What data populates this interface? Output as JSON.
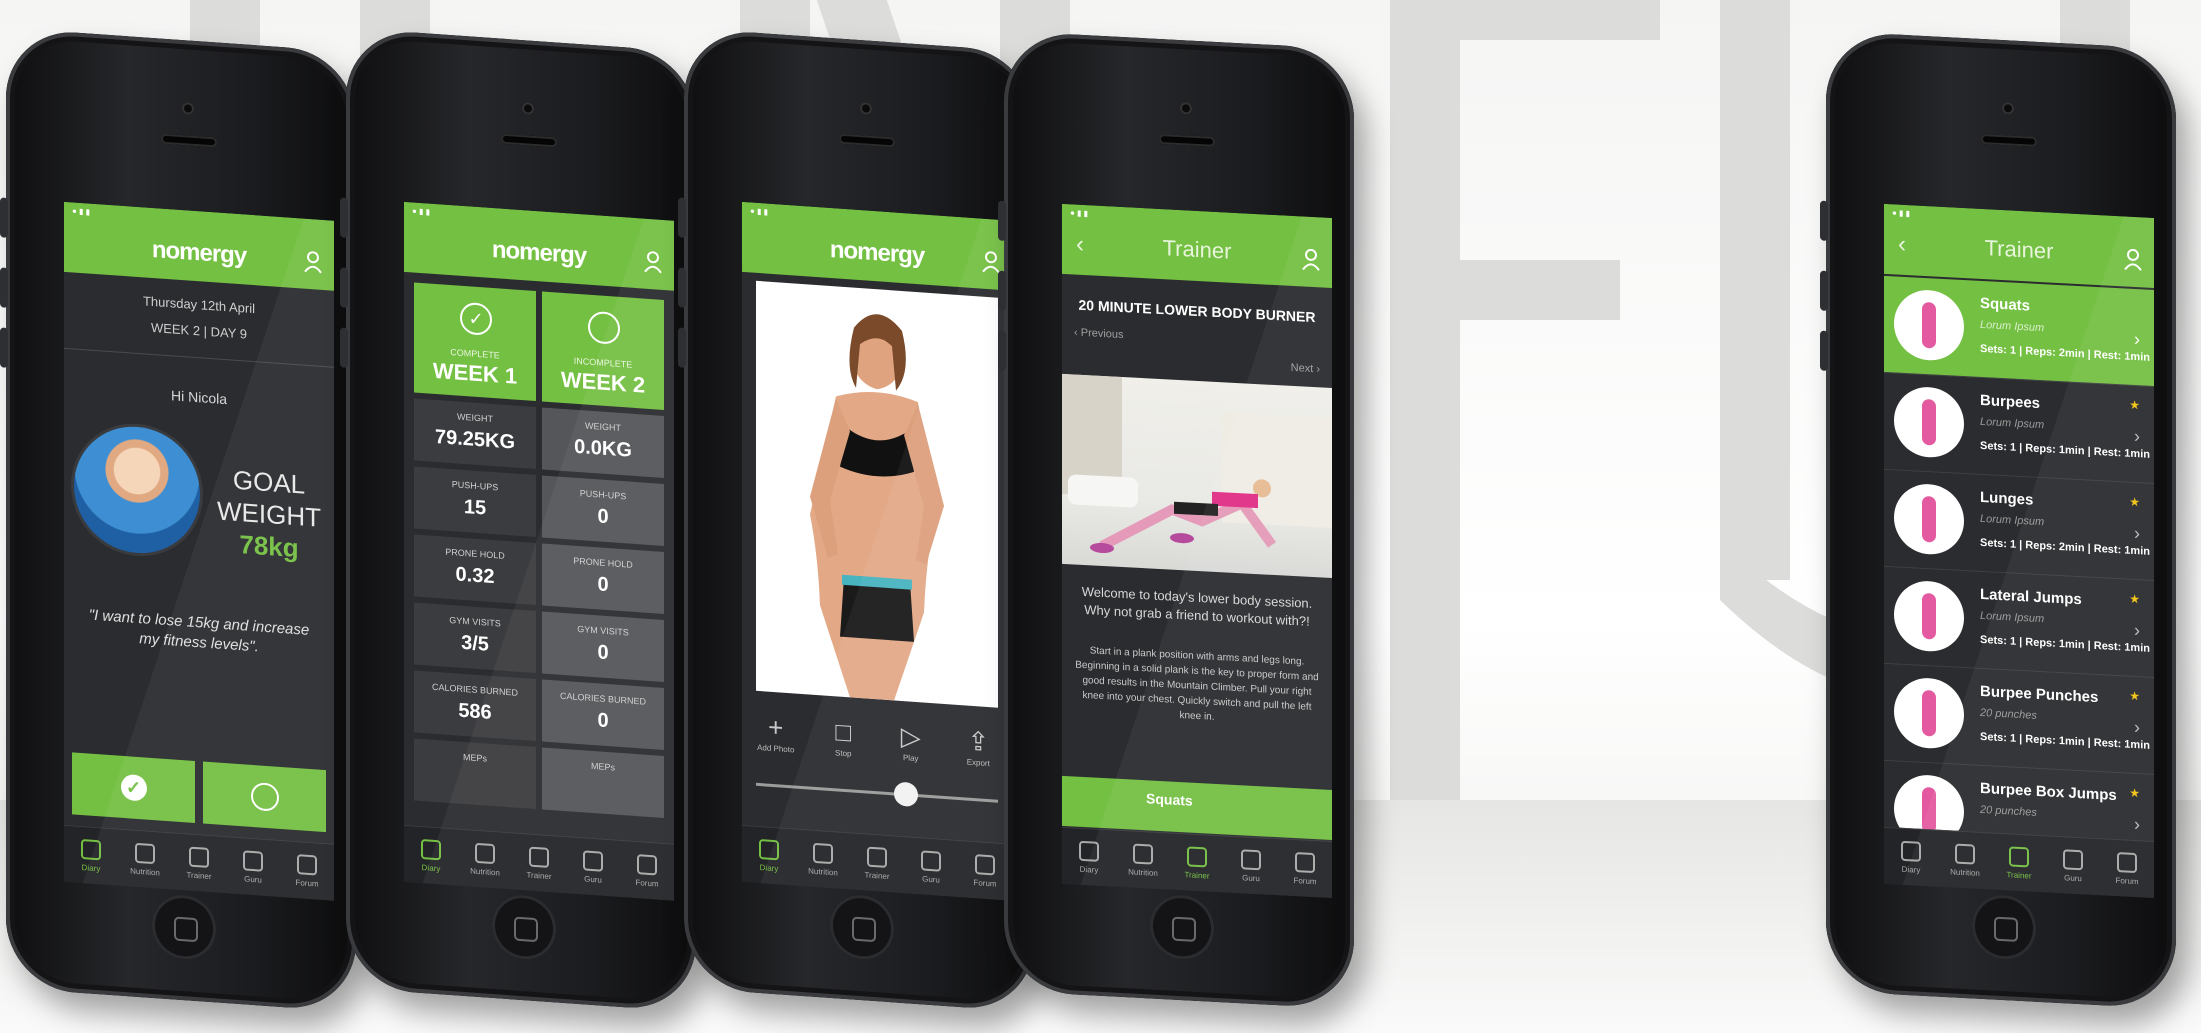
{
  "colors": {
    "accent": "#74c043",
    "screen_bg": "#2b2c2f",
    "star": "#f2c312"
  },
  "tabbar": [
    {
      "label": "Diary",
      "icon": "diary-icon"
    },
    {
      "label": "Nutrition",
      "icon": "nutrition-icon"
    },
    {
      "label": "Trainer",
      "icon": "trainer-icon"
    },
    {
      "label": "Guru",
      "icon": "guru-icon"
    },
    {
      "label": "Forum",
      "icon": "forum-icon"
    }
  ],
  "screen1": {
    "logo": "nomergy",
    "date": "Thursday 12th April",
    "week": "WEEK 2 | DAY 9",
    "greeting": "Hi Nicola",
    "goal_line1": "GOAL",
    "goal_line2": "WEIGHT",
    "goal_value": "78kg",
    "quote": "\"I want to lose 15kg and increase my fitness levels\".",
    "active_tab": "Diary"
  },
  "screen2": {
    "logo": "nomergy",
    "weeks": [
      {
        "status": "COMPLETE",
        "label": "WEEK 1",
        "icon": "check-icon"
      },
      {
        "status": "INCOMPLETE",
        "label": "WEEK 2",
        "icon": "circle-icon"
      }
    ],
    "stats": [
      {
        "label": "WEIGHT",
        "week1": "79.25KG",
        "week2": "0.0KG"
      },
      {
        "label": "PUSH-UPS",
        "week1": "15",
        "week2": "0"
      },
      {
        "label": "PRONE HOLD",
        "week1": "0.32",
        "week2": "0"
      },
      {
        "label": "GYM VISITS",
        "week1": "3/5",
        "week2": "0"
      },
      {
        "label": "CALORIES BURNED",
        "week1": "586",
        "week2": "0"
      },
      {
        "label": "MEPs",
        "week1": "",
        "week2": ""
      }
    ],
    "active_tab": "Diary"
  },
  "screen3": {
    "logo": "nomergy",
    "tools": [
      {
        "label": "Add Photo",
        "icon": "plus-icon",
        "glyph": "+"
      },
      {
        "label": "Stop",
        "icon": "stop-icon",
        "glyph": "□"
      },
      {
        "label": "Play",
        "icon": "play-icon",
        "glyph": "▷"
      },
      {
        "label": "Export",
        "icon": "share-icon",
        "glyph": "⇪"
      }
    ],
    "slider_value": 0.62,
    "active_tab": "Diary"
  },
  "screen4": {
    "header": "Trainer",
    "title": "20 MINUTE LOWER BODY BURNER",
    "prev": "Previous",
    "next": "Next",
    "intro": "Welcome to today's lower body session. Why not grab a friend to workout with?!",
    "body": "Start in a plank position with arms and legs long. Beginning in a solid plank is the key to proper form and good results in the Mountain Climber. Pull your right knee into your chest. Quickly switch and pull the left knee in.",
    "bottom_item": "Squats",
    "active_tab": "Trainer"
  },
  "screen5": {
    "header": "Trainer",
    "exercises": [
      {
        "name": "Squats",
        "sub": "Lorum Ipsum",
        "meta": "Sets: 1 | Reps: 2min | Rest: 1min",
        "star": ""
      },
      {
        "name": "Burpees",
        "sub": "Lorum Ipsum",
        "meta": "Sets: 1 | Reps: 1min | Rest: 1min",
        "star": "★"
      },
      {
        "name": "Lunges",
        "sub": "Lorum Ipsum",
        "meta": "Sets: 1 | Reps: 2min | Rest: 1min",
        "star": "★"
      },
      {
        "name": "Lateral Jumps",
        "sub": "Lorum Ipsum",
        "meta": "Sets: 1 | Reps: 1min | Rest: 1min",
        "star": "★"
      },
      {
        "name": "Burpee Punches",
        "sub": "20 punches",
        "meta": "Sets: 1 | Reps: 1min | Rest: 1min",
        "star": "★"
      },
      {
        "name": "Burpee Box Jumps",
        "sub": "20 punches",
        "meta": "",
        "star": "★"
      }
    ],
    "active_tab": "Trainer"
  }
}
